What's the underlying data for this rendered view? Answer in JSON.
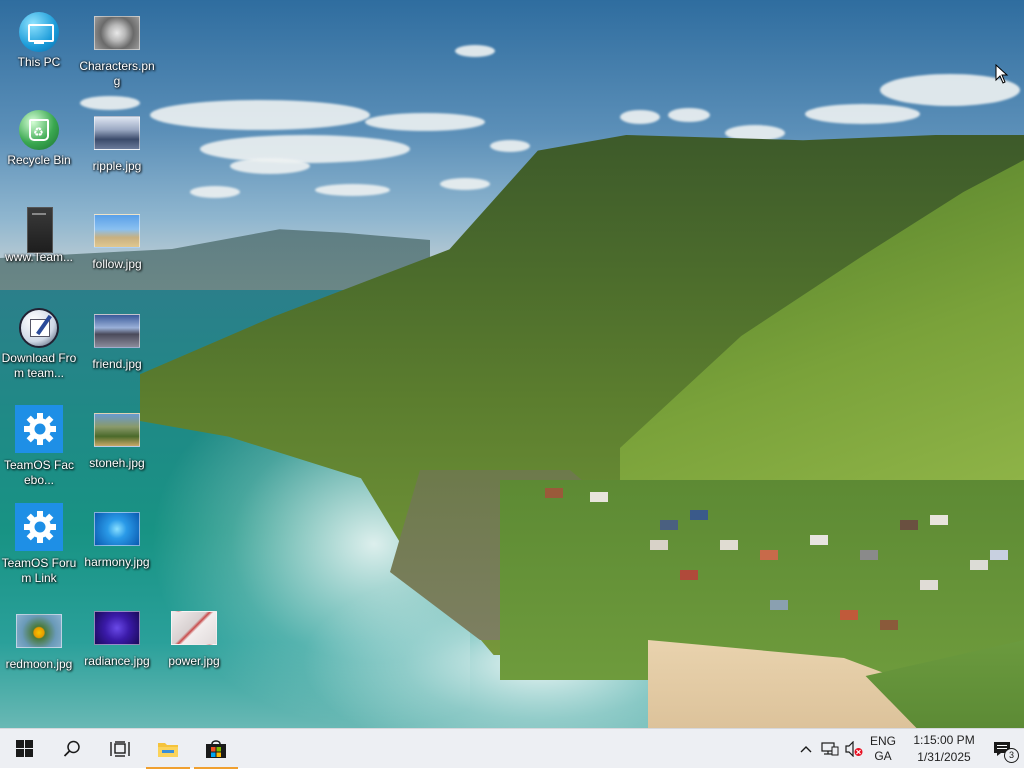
{
  "desktop": {
    "icons": [
      {
        "label": "This PC",
        "icon": "computer-icon"
      },
      {
        "label": "Characters.png",
        "icon": "image-file-icon"
      },
      {
        "label": "Recycle Bin",
        "icon": "recycle-bin-icon"
      },
      {
        "label": "ripple.jpg",
        "icon": "image-file-icon"
      },
      {
        "label": "www.Team...",
        "icon": "shortcut-file-icon"
      },
      {
        "label": "follow.jpg",
        "icon": "image-file-icon"
      },
      {
        "label": "Download From team...",
        "icon": "download-shortcut-icon"
      },
      {
        "label": "friend.jpg",
        "icon": "image-file-icon"
      },
      {
        "label": "TeamOS Facebo...",
        "icon": "gear-icon"
      },
      {
        "label": "stoneh.jpg",
        "icon": "image-file-icon"
      },
      {
        "label": "TeamOS Forum Link",
        "icon": "gear-icon"
      },
      {
        "label": "harmony.jpg",
        "icon": "image-file-icon"
      },
      {
        "label": "redmoon.jpg",
        "icon": "image-file-icon"
      },
      {
        "label": "radiance.jpg",
        "icon": "image-file-icon"
      },
      {
        "label": "power.jpg",
        "icon": "image-file-icon"
      }
    ]
  },
  "taskbar": {
    "start_icon": "windows-start-icon",
    "search_icon": "search-icon",
    "taskview_icon": "task-view-icon",
    "pinned": [
      {
        "name": "File Explorer",
        "icon": "folder-icon"
      },
      {
        "name": "Microsoft Store",
        "icon": "store-icon"
      }
    ],
    "tray": {
      "chevron_icon": "chevron-up-icon",
      "network_icon": "network-icon",
      "volume_icon": "volume-muted-icon",
      "lang_line1": "ENG",
      "lang_line2": "GA",
      "time": "1:15:00 PM",
      "date": "1/31/2025",
      "notification_count": "3"
    }
  },
  "colors": {
    "accent": "#f0a030",
    "taskbar_bg": "#edeff3",
    "gear_blue": "#1e8fe6"
  }
}
